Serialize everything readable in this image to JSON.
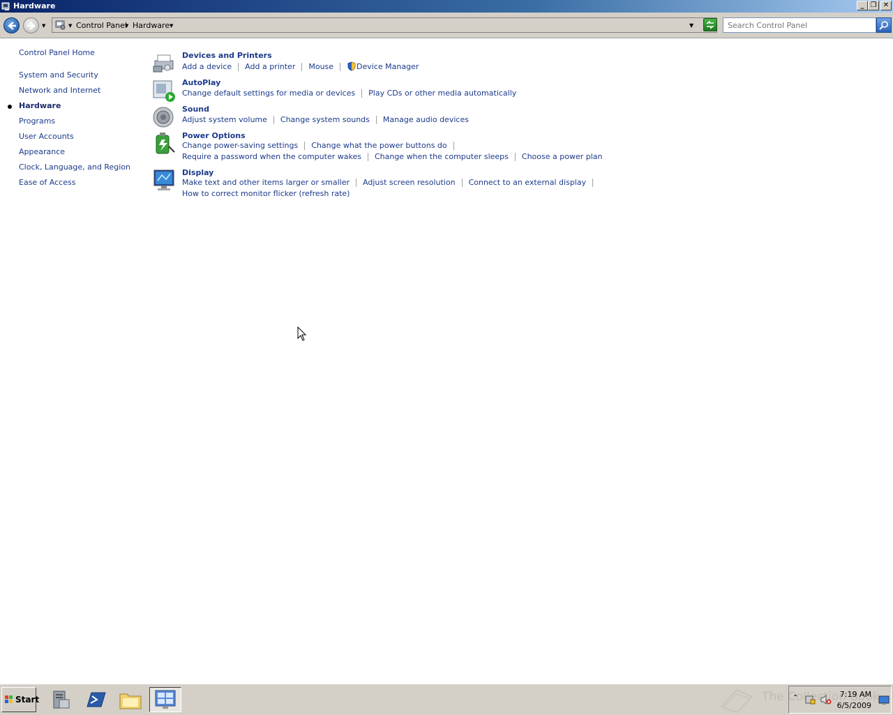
{
  "window": {
    "title": "Hardware"
  },
  "address_bar": {
    "crumbs": [
      "Control Panel",
      "Hardware"
    ],
    "search_placeholder": "Search Control Panel"
  },
  "sidebar": {
    "home": "Control Panel Home",
    "items": [
      {
        "label": "System and Security",
        "active": false
      },
      {
        "label": "Network and Internet",
        "active": false
      },
      {
        "label": "Hardware",
        "active": true
      },
      {
        "label": "Programs",
        "active": false
      },
      {
        "label": "User Accounts",
        "active": false
      },
      {
        "label": "Appearance",
        "active": false
      },
      {
        "label": "Clock, Language, and Region",
        "active": false
      },
      {
        "label": "Ease of Access",
        "active": false
      }
    ]
  },
  "categories": [
    {
      "title": "Devices and Printers",
      "icon": "printer-icon",
      "rows": [
        [
          "Add a device",
          "Add a printer",
          "Mouse",
          "Device Manager"
        ]
      ]
    },
    {
      "title": "AutoPlay",
      "icon": "autoplay-icon",
      "rows": [
        [
          "Change default settings for media or devices",
          "Play CDs or other media automatically"
        ]
      ]
    },
    {
      "title": "Sound",
      "icon": "speaker-icon",
      "rows": [
        [
          "Adjust system volume",
          "Change system sounds",
          "Manage audio devices"
        ]
      ]
    },
    {
      "title": "Power Options",
      "icon": "battery-icon",
      "rows": [
        [
          "Change power-saving settings",
          "Change what the power buttons do"
        ],
        [
          "Require a password when the computer wakes",
          "Change when the computer sleeps",
          "Choose a power plan"
        ]
      ]
    },
    {
      "title": "Display",
      "icon": "monitor-icon",
      "rows": [
        [
          "Make text and other items larger or smaller",
          "Adjust screen resolution",
          "Connect to an external display"
        ],
        [
          "How to correct monitor flicker (refresh rate)"
        ]
      ]
    }
  ],
  "taskbar": {
    "start_label": "Start",
    "clock_time": "7:19 AM",
    "clock_date": "6/5/2009",
    "watermark": "The Collection Book"
  },
  "colors": {
    "link": "#1c3a8a",
    "title_bar": "#0a246a",
    "taskbar": "#d4d0c8"
  }
}
